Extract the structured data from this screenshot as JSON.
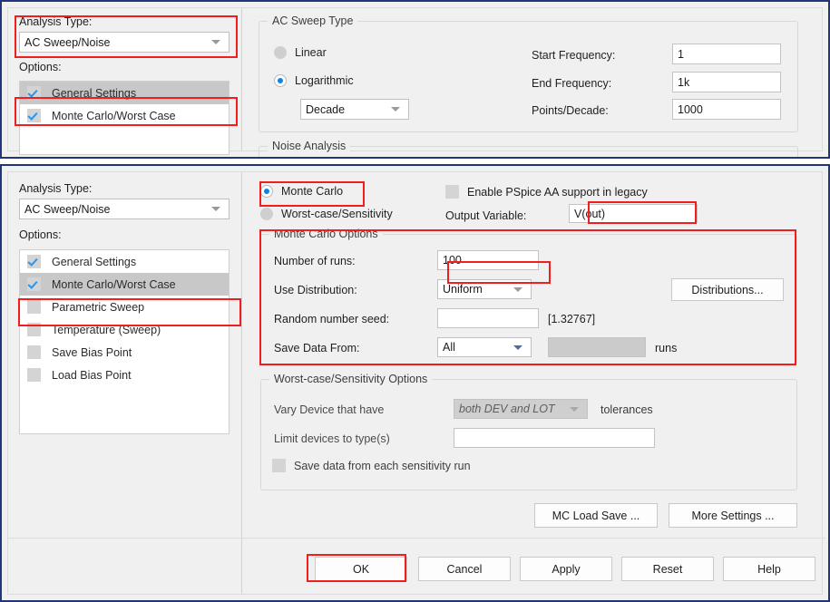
{
  "top_panel": {
    "analysis_type_label": "Analysis Type:",
    "analysis_type_value": "AC Sweep/Noise",
    "options_label": "Options:",
    "options": [
      {
        "label": "General Settings",
        "checked": true,
        "selected": true
      },
      {
        "label": "Monte Carlo/Worst Case",
        "checked": true,
        "selected": false
      }
    ],
    "ac_sweep_type": {
      "title": "AC Sweep Type",
      "linear_label": "Linear",
      "logarithmic_label": "Logarithmic",
      "selected": "Logarithmic",
      "scale_value": "Decade",
      "start_frequency_label": "Start Frequency:",
      "start_frequency_value": "1",
      "end_frequency_label": "End Frequency:",
      "end_frequency_value": "1k",
      "points_label": "Points/Decade:",
      "points_value": "1000"
    },
    "noise_analysis_title": "Noise Analysis"
  },
  "bottom_panel": {
    "analysis_type_label": "Analysis Type:",
    "analysis_type_value": "AC Sweep/Noise",
    "options_label": "Options:",
    "options": [
      {
        "label": "General Settings",
        "checked": true,
        "selected": false
      },
      {
        "label": "Monte Carlo/Worst Case",
        "checked": true,
        "selected": true
      },
      {
        "label": "Parametric Sweep",
        "checked": false,
        "selected": false
      },
      {
        "label": "Temperature (Sweep)",
        "checked": false,
        "selected": false
      },
      {
        "label": "Save Bias Point",
        "checked": false,
        "selected": false
      },
      {
        "label": "Load Bias Point",
        "checked": false,
        "selected": false
      }
    ],
    "mode": {
      "monte_carlo_label": "Monte Carlo",
      "worst_case_label": "Worst-case/Sensitivity",
      "selected": "Monte Carlo"
    },
    "enable_aa_label": "Enable PSpice AA support in legacy",
    "enable_aa_checked": false,
    "output_variable_label": "Output Variable:",
    "output_variable_value": "V(out)",
    "monte_carlo_options": {
      "title": "Monte Carlo Options",
      "number_of_runs_label": "Number of runs:",
      "number_of_runs_value": "100",
      "use_distribution_label": "Use Distribution:",
      "use_distribution_value": "Uniform",
      "distributions_button": "Distributions...",
      "random_seed_label": "Random number seed:",
      "random_seed_value": "",
      "random_seed_hint": "[1.32767]",
      "save_data_from_label": "Save Data From:",
      "save_data_from_value": "All",
      "save_data_runs_value": "",
      "runs_suffix": "runs"
    },
    "worst_case_options": {
      "title": "Worst-case/Sensitivity Options",
      "vary_device_label": "Vary Device that have",
      "vary_device_value": "both DEV and LOT",
      "tolerances_suffix": "tolerances",
      "limit_devices_label": "Limit devices to type(s)",
      "limit_devices_value": "",
      "save_sensitivity_label": "Save data from each sensitivity run",
      "save_sensitivity_checked": false
    },
    "action_buttons": {
      "mc_load_save": "MC Load Save ...",
      "more_settings": "More Settings ..."
    },
    "dialog_buttons": [
      {
        "label": "OK",
        "highlighted": true
      },
      {
        "label": "Cancel",
        "highlighted": false
      },
      {
        "label": "Apply",
        "highlighted": false
      },
      {
        "label": "Reset",
        "highlighted": false
      },
      {
        "label": "Help",
        "highlighted": false
      }
    ]
  },
  "colors": {
    "annotation": "#ef1f1f",
    "panel_border": "#23357a",
    "accent": "#0a84e8"
  }
}
